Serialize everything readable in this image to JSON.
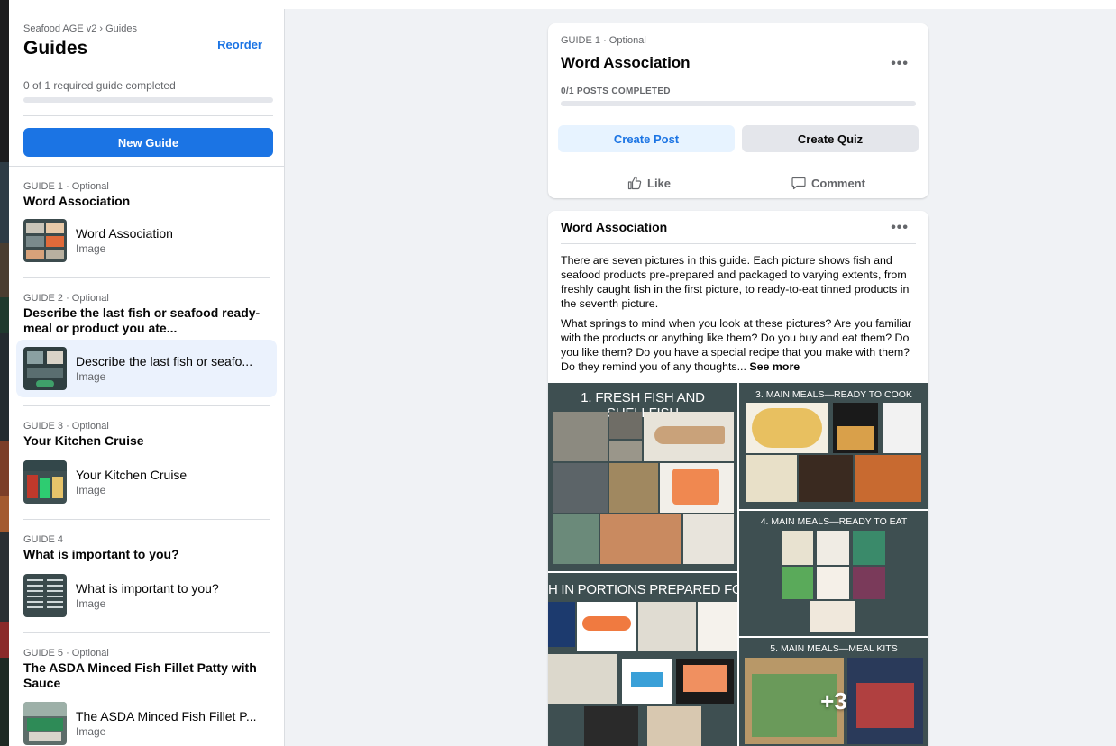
{
  "sidebar": {
    "breadcrumb": "Seafood AGE v2 › Guides",
    "title": "Guides",
    "reorder_label": "Reorder",
    "progress_text": "0 of 1 required guide completed",
    "progress_fraction": 0,
    "new_guide_label": "New Guide",
    "guides": [
      {
        "label": "GUIDE 1 · Optional",
        "title": "Word Association",
        "item_title": "Word Association",
        "item_type": "Image"
      },
      {
        "label": "GUIDE 2 · Optional",
        "title": "Describe the last fish or seafood ready-meal or product you ate...",
        "item_title": "Describe the last fish or seafo...",
        "item_type": "Image"
      },
      {
        "label": "GUIDE 3 · Optional",
        "title": "Your Kitchen Cruise",
        "item_title": "Your Kitchen Cruise",
        "item_type": "Image"
      },
      {
        "label": "GUIDE 4",
        "title": "What is important to you?",
        "item_title": "What is important to you?",
        "item_type": "Image"
      },
      {
        "label": "GUIDE 5 · Optional",
        "title": "The ASDA Minced Fish Fillet Patty with Sauce",
        "item_title": "The ASDA Minced Fish Fillet P...",
        "item_type": "Image"
      }
    ]
  },
  "guide_card": {
    "label": "GUIDE 1 · Optional",
    "title": "Word Association",
    "more": "•••",
    "posts_completed": "0/1 POSTS COMPLETED",
    "posts_fraction": 0,
    "create_post_label": "Create Post",
    "create_quiz_label": "Create Quiz",
    "like_label": "Like",
    "comment_label": "Comment"
  },
  "post_card": {
    "title": "Word Association",
    "more": "•••",
    "paragraph1": "There are seven pictures in this guide. Each picture shows  fish and seafood products pre-prepared and packaged to varying extents, from freshly caught fish in the first picture, to ready-to-eat tinned products in the seventh picture.",
    "paragraph2": "What springs to mind when you look at these pictures? Are you familiar with the products or anything like them? Do you buy and eat them? Do you like them? Do you have a special recipe that you make with them? Do they remind you of any thoughts...",
    "see_more": "See more",
    "gallery": {
      "tile1_heading": "1. FRESH FISH AND SHELLFISH",
      "tile2_heading": "H IN PORTIONS PREPARED FOR COO",
      "tile3_heading": "3. MAIN MEALS—READY TO COOK",
      "tile4_heading": "4. MAIN MEALS—READY TO EAT",
      "tile5_heading": "5. MAIN MEALS—MEAL KITS",
      "overflow_count": "+3"
    }
  },
  "colors": {
    "accent": "#1b74e4",
    "accent_light": "#e7f3ff",
    "page_bg": "#f0f2f5",
    "tile_bg": "#3e4f51"
  }
}
